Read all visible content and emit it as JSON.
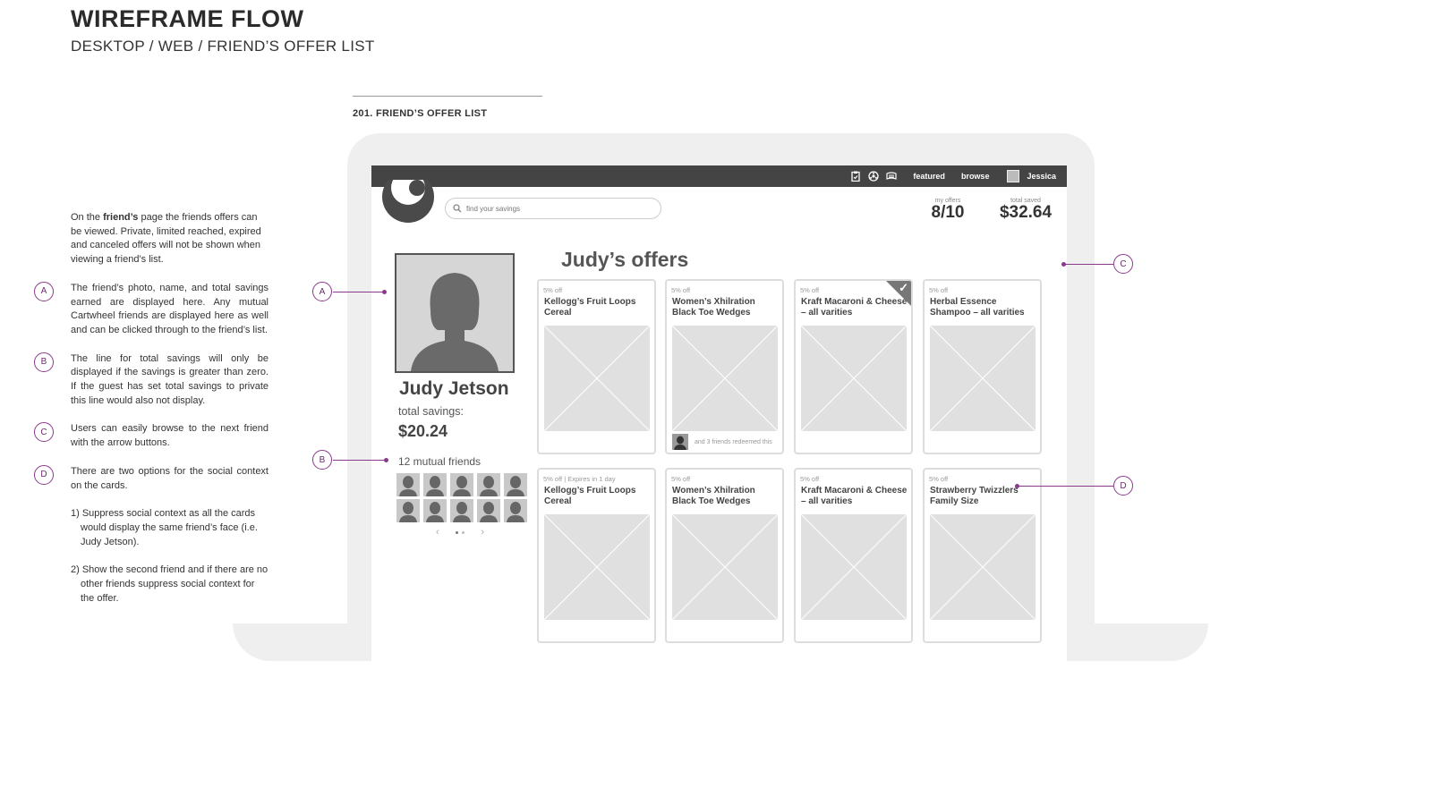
{
  "header": {
    "title": "WIREFRAME FLOW",
    "subtitle": "DESKTOP / WEB / FRIEND’S OFFER LIST"
  },
  "screen_label": "201.  FRIEND’S OFFER LIST",
  "notes": {
    "intro_prefix": "On the ",
    "intro_bold": "friend’s",
    "intro_suffix": " page the friends offers can be viewed. Private, limited reached, expired and canceled offers will not be shown when viewing a friend’s list.",
    "items": [
      {
        "badge": "A",
        "text": "The friend’s photo, name, and total savings earned are displayed here. Any mutual Cartwheel friends are displayed here as well and can be clicked through to the friend’s list."
      },
      {
        "badge": "B",
        "text": "The line for total savings will only be displayed if the savings is greater than zero. If the guest has set total savings to private this line would also not display."
      },
      {
        "badge": "C",
        "text": "Users can easily browse to the next friend with the arrow buttons."
      },
      {
        "badge": "D",
        "text": "There are two options for the social context on the cards."
      }
    ],
    "options": [
      "1) Suppress social context as all the cards would display the same friend’s face (i.e. Judy Jetson).",
      "2) Show the second friend and if there are no other friends suppress social context for the offer."
    ]
  },
  "app": {
    "topbar": {
      "featured": "featured",
      "browse": "browse",
      "user": "Jessica",
      "icons": [
        "clipboard-icon",
        "cartwheel-icon",
        "list-icon"
      ]
    },
    "search_placeholder": "find your savings",
    "stats": {
      "offers_label": "my offers",
      "offers_value": "8/10",
      "saved_label": "total saved",
      "saved_value": "$32.64"
    },
    "profile": {
      "name": "Judy Jetson",
      "savings_label": "total savings:",
      "savings_value": "$20.24",
      "mutual_label": "12 mutual friends",
      "mutual_count_shown": 10
    },
    "offers_title": "Judy’s offers",
    "offers": [
      {
        "discount": "5% off",
        "title": "Kellogg’s Fruit Loops Cereal"
      },
      {
        "discount": "5% off",
        "title": "Women’s Xhilration Black Toe Wedges",
        "social": "and 3 friends redeemed this"
      },
      {
        "discount": "5% off",
        "title": "Kraft Macaroni & Cheese – all varities",
        "checked": true
      },
      {
        "discount": "5% off",
        "title": "Herbal Essence Shampoo – all varities"
      },
      {
        "discount": "5% off   |   Expires in 1 day",
        "title": "Kellogg’s Fruit Loops Cereal"
      },
      {
        "discount": "5% off",
        "title": "Women’s Xhilration Black Toe Wedges"
      },
      {
        "discount": "5% off",
        "title": "Kraft Macaroni & Cheese – all varities"
      },
      {
        "discount": "5% off",
        "title": "Strawberry Twizzlers Family Size"
      }
    ]
  },
  "callouts": [
    "A",
    "B",
    "C",
    "D"
  ],
  "colors": {
    "accent": "#8a3a8a",
    "topbar": "#444444",
    "bezel": "#efefef"
  }
}
